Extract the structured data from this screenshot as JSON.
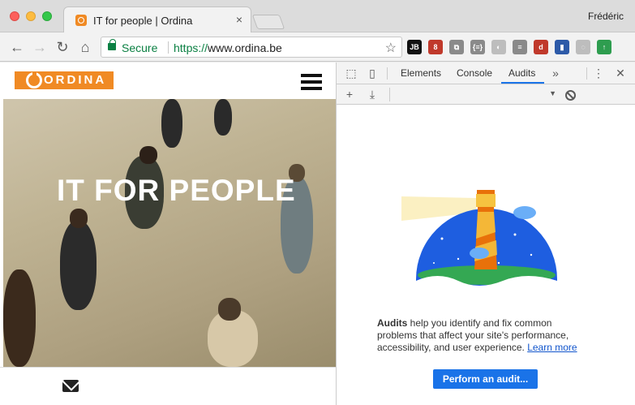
{
  "browser": {
    "tab_title": "IT for people | Ordina",
    "tab_close": "×",
    "profile_name": "Frédéric",
    "nav": {
      "back": "←",
      "forward": "→",
      "reload": "↻",
      "home": "⌂"
    },
    "omnibox": {
      "secure_label": "Secure",
      "url_scheme": "https://",
      "url_host": "www.ordina.be",
      "star": "☆"
    },
    "extensions": [
      {
        "name": "jetbrains-icon",
        "label": "JB",
        "color": "#111111"
      },
      {
        "name": "ublock-icon",
        "label": "8",
        "color": "#c0392b"
      },
      {
        "name": "cast-icon",
        "label": "⧉",
        "color": "#8a8a8a"
      },
      {
        "name": "json-icon",
        "label": "{≡}",
        "color": "#8a8a8a"
      },
      {
        "name": "extension-icon-5",
        "label": "◐",
        "color": "#bdbdbd"
      },
      {
        "name": "reader-icon",
        "label": "≡",
        "color": "#8a8a8a"
      },
      {
        "name": "extension-icon-7",
        "label": "d",
        "color": "#c0392b"
      },
      {
        "name": "extension-icon-8",
        "label": "▮",
        "color": "#2d5aa8"
      },
      {
        "name": "extension-icon-9",
        "label": "◌",
        "color": "#bdbdbd"
      },
      {
        "name": "upload-icon",
        "label": "↑",
        "color": "#2e9d4f"
      }
    ],
    "brand_color": "#f08a24",
    "secure_color": "#0b8043"
  },
  "page": {
    "logo_text": "ORDINA",
    "hero_title": "IT FOR PEOPLE"
  },
  "devtools": {
    "tabs": [
      {
        "label": "Elements"
      },
      {
        "label": "Console"
      },
      {
        "label": "Audits"
      }
    ],
    "active_tab": "Audits",
    "more_tabs": "»",
    "menu": "⋮",
    "close": "✕",
    "toolbar": {
      "add": "+",
      "download": "⤓",
      "dropdown_arrow": "▼"
    },
    "audits": {
      "intro_bold": "Audits",
      "intro_text": " help you identify and fix common problems that affect your site's performance, accessibility, and user experience. ",
      "learn_more": "Learn more",
      "button_label": "Perform an audit..."
    },
    "accent_color": "#1a73e8"
  }
}
